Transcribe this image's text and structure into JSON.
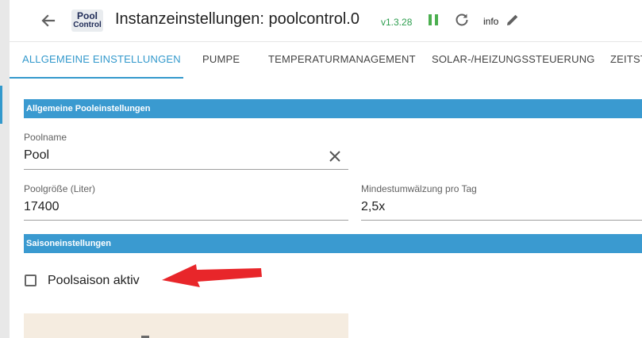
{
  "header": {
    "logo_line1": "Pool",
    "logo_line2": "Control",
    "title": "Instanzeinstellungen: poolcontrol.0",
    "version": "v1.3.28",
    "loglevel": "info"
  },
  "tabs": [
    {
      "label": "ALLGEMEINE EINSTELLUNGEN",
      "active": true
    },
    {
      "label": "PUMPE"
    },
    {
      "label": "TEMPERATURMANAGEMENT"
    },
    {
      "label": "SOLAR-/HEIZUNGSSTEUERUNG"
    },
    {
      "label": "ZEITST"
    }
  ],
  "general": {
    "title": "Allgemeine Pooleinstellungen",
    "pool_name_label": "Poolname",
    "pool_name_value": "Pool",
    "pool_size_label": "Poolgröße (Liter)",
    "pool_size_value": "17400",
    "circulation_label": "Mindestumwälzung pro Tag",
    "circulation_value": "2,5x"
  },
  "season": {
    "title": "Saisoneinstellungen",
    "checkbox_label": "Poolsaison aktiv",
    "checked": false
  },
  "colors": {
    "accent": "#3399cc",
    "section_bar": "#3a9ad0",
    "version": "#2e9e4f",
    "annotation_arrow": "#e8262a"
  }
}
